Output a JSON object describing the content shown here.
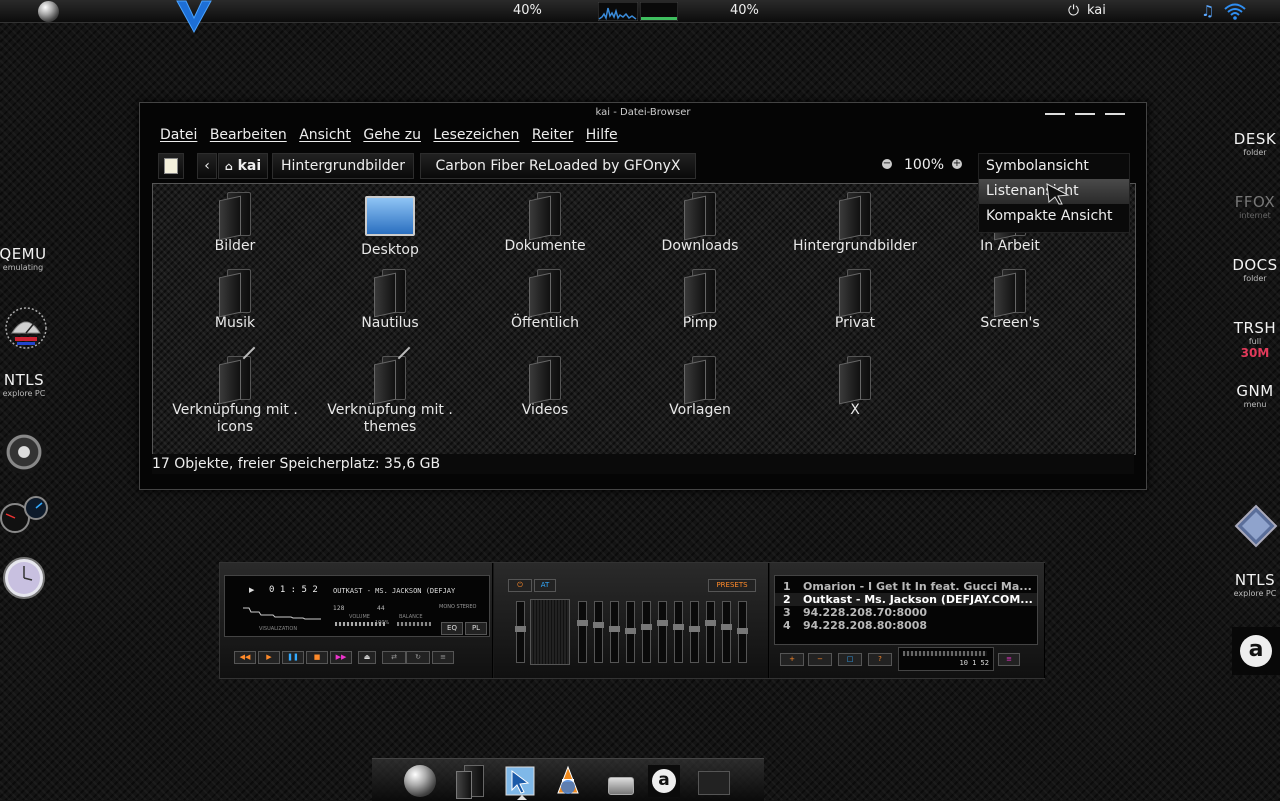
{
  "top_panel": {
    "left_logo_icon": "sphere-logo-icon",
    "vortex_icon": "blue-v-icon",
    "cpu_percent_1": "40%",
    "cpu_percent_2": "40%",
    "user_label": "kai",
    "power_icon": "power-icon",
    "music_icon": "music-note-icon",
    "wifi_icon": "wifi-icon"
  },
  "left_launchers": [
    {
      "big": "QEMU",
      "small": "emulating"
    },
    {
      "big": "NTLS",
      "small": "explore PC"
    }
  ],
  "right_launchers": [
    {
      "big": "DESK",
      "small": "folder"
    },
    {
      "big": "FFOX",
      "small": "internet"
    },
    {
      "big": "DOCS",
      "small": "folder"
    },
    {
      "big": "TRSH",
      "small": "full",
      "extra": "30M"
    },
    {
      "big": "GNM",
      "small": "menu"
    },
    {
      "big": "NTLS",
      "small": "explore PC"
    }
  ],
  "window": {
    "title": "kai - Datei-Browser",
    "menu": [
      "Datei",
      "Bearbeiten",
      "Ansicht",
      "Gehe zu",
      "Lesezeichen",
      "Reiter",
      "Hilfe"
    ],
    "breadcrumb": {
      "home": "kai",
      "crumb1": "Hintergrundbilder",
      "crumb2": "Carbon Fiber ReLoaded by GFOnyX"
    },
    "zoom": "100%",
    "view_menu": {
      "items": [
        "Symbolansicht",
        "Listenansicht",
        "Kompakte Ansicht"
      ],
      "highlighted_index": 1
    },
    "files": [
      {
        "name": "Bilder"
      },
      {
        "name": "Desktop"
      },
      {
        "name": "Dokumente"
      },
      {
        "name": "Downloads"
      },
      {
        "name": "Hintergrundbilder"
      },
      {
        "name": "In Arbeit"
      },
      {
        "name": "Musik"
      },
      {
        "name": "Nautilus"
      },
      {
        "name": "Öffentlich"
      },
      {
        "name": "Pimp"
      },
      {
        "name": "Privat"
      },
      {
        "name": "Screen's"
      },
      {
        "name": "Verknüpfung mit . icons"
      },
      {
        "name": "Verknüpfung mit . themes"
      },
      {
        "name": "Videos"
      },
      {
        "name": "Vorlagen"
      },
      {
        "name": "X"
      }
    ],
    "status": "17 Objekte, freier Speicherplatz: 35,6 GB"
  },
  "winamp": {
    "time": "0 1 : 5 2",
    "marquee": "OUTKAST - MS. JACKSON (DEFJAY",
    "kbps": "128",
    "khz": "44",
    "mono_stereo": "MONO STEREO",
    "vis_label": "VISUALIZATION",
    "volume_label": "VOLUME",
    "balance_label": "BALANCE",
    "vol_pct": "100%",
    "eq_btn": "EQ",
    "pl_btn": "PL",
    "presets": "PRESETS",
    "on_label": "ON",
    "at_label": "AT",
    "playlist": [
      {
        "num": "1",
        "title": "Omarion - I Get It In feat. Gucci Ma..."
      },
      {
        "num": "2",
        "title": "Outkast - Ms. Jackson (DEFJAY.COM..."
      },
      {
        "num": "3",
        "title": "94.228.208.70:8000"
      },
      {
        "num": "4",
        "title": "94.228.208.80:8008"
      }
    ],
    "selected_track": 2,
    "mini_time": "10 1 52"
  },
  "dock": {
    "icons": [
      "sphere-logo-icon",
      "folder-icon",
      "cursor-icon",
      "vlc-cone-icon",
      "drive-icon",
      "avant-icon",
      "terminal-icon"
    ]
  }
}
